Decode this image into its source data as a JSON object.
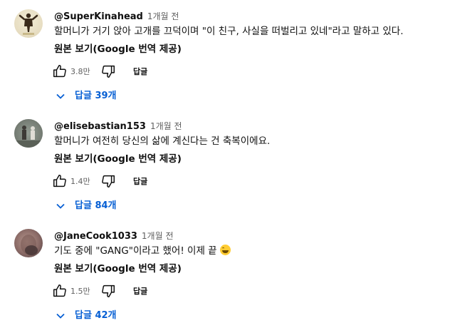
{
  "comments": [
    {
      "handle": "@SuperKinahead",
      "time": "1개월 전",
      "text": "할머니가 거기 앉아 고개를 끄덕이며 \"이 친구, 사실을 떠벌리고 있네\"라고 말하고 있다.",
      "translate": "원본 보기(Google 번역 제공)",
      "likes": "3.8만",
      "reply": "답글",
      "replies": "답글 39개"
    },
    {
      "handle": "@elisebastian153",
      "time": "1개월 전",
      "text": "할머니가 여전히 당신의 삶에 계신다는 건 축복이에요.",
      "translate": "원본 보기(Google 번역 제공)",
      "likes": "1.4만",
      "reply": "답글",
      "replies": "답글 84개"
    },
    {
      "handle": "@JaneCook1033",
      "time": "1개월 전",
      "text": "기도 중에 \"GANG\"이라고 했어! 이제 끝",
      "emoji": "face-with-tears-of-joy",
      "translate": "원본 보기(Google 번역 제공)",
      "likes": "1.5만",
      "reply": "답글",
      "replies": "답글 42개"
    }
  ],
  "colors": {
    "link": "#065fd4",
    "secondary": "#606060",
    "text": "#0f0f0f"
  }
}
